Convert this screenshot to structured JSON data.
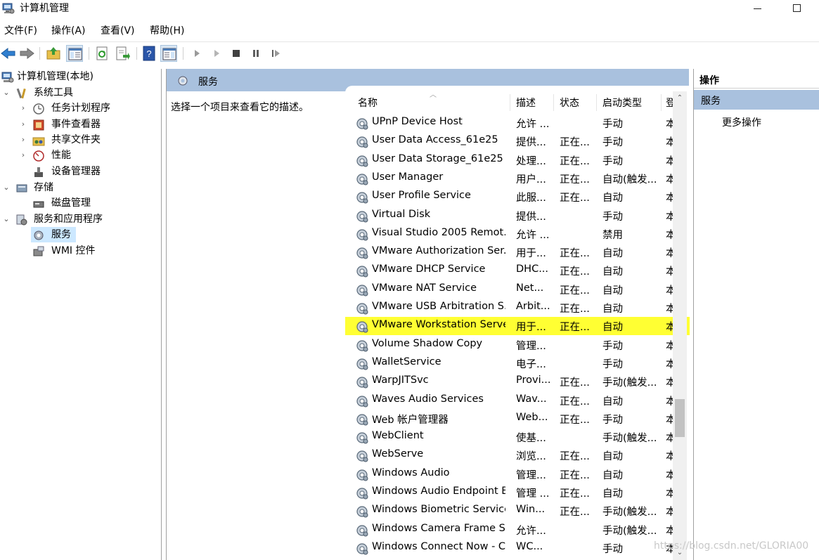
{
  "window": {
    "title": "计算机管理"
  },
  "menu": [
    "文件(F)",
    "操作(A)",
    "查看(V)",
    "帮助(H)"
  ],
  "tree": [
    {
      "label": "计算机管理(本地)",
      "icon": "computer-management-icon",
      "level": 0,
      "expander": ""
    },
    {
      "label": "系统工具",
      "icon": "tools-icon",
      "level": 1,
      "expander": "⌄"
    },
    {
      "label": "任务计划程序",
      "icon": "clock-icon",
      "level": 2,
      "expander": "›"
    },
    {
      "label": "事件查看器",
      "icon": "event-viewer-icon",
      "level": 2,
      "expander": "›"
    },
    {
      "label": "共享文件夹",
      "icon": "shared-folder-icon",
      "level": 2,
      "expander": "›"
    },
    {
      "label": "性能",
      "icon": "performance-icon",
      "level": 2,
      "expander": "›"
    },
    {
      "label": "设备管理器",
      "icon": "device-manager-icon",
      "level": 2,
      "expander": ""
    },
    {
      "label": "存储",
      "icon": "storage-icon",
      "level": 1,
      "expander": "⌄"
    },
    {
      "label": "磁盘管理",
      "icon": "disk-icon",
      "level": 2,
      "expander": ""
    },
    {
      "label": "服务和应用程序",
      "icon": "services-apps-icon",
      "level": 1,
      "expander": "⌄"
    },
    {
      "label": "服务",
      "icon": "gear-icon",
      "level": 2,
      "expander": "",
      "selected": true
    },
    {
      "label": "WMI 控件",
      "icon": "wmi-icon",
      "level": 2,
      "expander": ""
    }
  ],
  "middle": {
    "header": "服务",
    "description": "选择一个项目来查看它的描述。",
    "columns": {
      "name": "名称",
      "desc": "描述",
      "status": "状态",
      "start": "启动类型",
      "logon": "登"
    },
    "rows": [
      {
        "name": "UPnP Device Host",
        "desc": "允许 ...",
        "status": "",
        "start": "手动",
        "logon": "本"
      },
      {
        "name": "User Data Access_61e25",
        "desc": "提供...",
        "status": "正在...",
        "start": "手动",
        "logon": "本"
      },
      {
        "name": "User Data Storage_61e25",
        "desc": "处理...",
        "status": "正在...",
        "start": "手动",
        "logon": "本"
      },
      {
        "name": "User Manager",
        "desc": "用户...",
        "status": "正在...",
        "start": "自动(触发...",
        "logon": "本"
      },
      {
        "name": "User Profile Service",
        "desc": "此服...",
        "status": "正在...",
        "start": "自动",
        "logon": "本"
      },
      {
        "name": "Virtual Disk",
        "desc": "提供...",
        "status": "",
        "start": "手动",
        "logon": "本"
      },
      {
        "name": "Visual Studio 2005 Remot...",
        "desc": "允许 ...",
        "status": "",
        "start": "禁用",
        "logon": "本"
      },
      {
        "name": "VMware Authorization Ser...",
        "desc": "用于...",
        "status": "正在...",
        "start": "自动",
        "logon": "本"
      },
      {
        "name": "VMware DHCP Service",
        "desc": "DHC...",
        "status": "正在...",
        "start": "自动",
        "logon": "本"
      },
      {
        "name": "VMware NAT Service",
        "desc": "Net...",
        "status": "正在...",
        "start": "自动",
        "logon": "本"
      },
      {
        "name": "VMware USB Arbitration S...",
        "desc": "Arbit...",
        "status": "正在...",
        "start": "自动",
        "logon": "本"
      },
      {
        "name": "VMware Workstation Server",
        "desc": "用于...",
        "status": "正在...",
        "start": "自动",
        "logon": "本",
        "highlight": true
      },
      {
        "name": "Volume Shadow Copy",
        "desc": "管理...",
        "status": "",
        "start": "手动",
        "logon": "本"
      },
      {
        "name": "WalletService",
        "desc": "电子...",
        "status": "",
        "start": "手动",
        "logon": "本"
      },
      {
        "name": "WarpJITSvc",
        "desc": "Provi...",
        "status": "正在...",
        "start": "手动(触发...",
        "logon": "本"
      },
      {
        "name": "Waves Audio Services",
        "desc": "Wav...",
        "status": "正在...",
        "start": "自动",
        "logon": "本"
      },
      {
        "name": "Web 帐户管理器",
        "desc": "Web...",
        "status": "正在...",
        "start": "手动",
        "logon": "本"
      },
      {
        "name": "WebClient",
        "desc": "使基...",
        "status": "",
        "start": "手动(触发...",
        "logon": "本"
      },
      {
        "name": "WebServe",
        "desc": "浏览...",
        "status": "正在...",
        "start": "自动",
        "logon": "本"
      },
      {
        "name": "Windows Audio",
        "desc": "管理...",
        "status": "正在...",
        "start": "自动",
        "logon": "本"
      },
      {
        "name": "Windows Audio Endpoint B...",
        "desc": "管理 ...",
        "status": "正在...",
        "start": "自动",
        "logon": "本"
      },
      {
        "name": "Windows Biometric Service",
        "desc": "Win...",
        "status": "正在...",
        "start": "手动(触发...",
        "logon": "本"
      },
      {
        "name": "Windows Camera Frame S...",
        "desc": "允许...",
        "status": "",
        "start": "手动(触发...",
        "logon": "本"
      },
      {
        "name": "Windows Connect Now - C...",
        "desc": "WC...",
        "status": "",
        "start": "手动",
        "logon": "本"
      }
    ]
  },
  "actions": {
    "header": "操作",
    "section": "服务",
    "item": "更多操作"
  },
  "watermark": "https://blog.csdn.net/GLORIA00",
  "colors": {
    "highlight": "#ffff33",
    "header_blue": "#a9c1de",
    "selection": "#cce8ff"
  }
}
